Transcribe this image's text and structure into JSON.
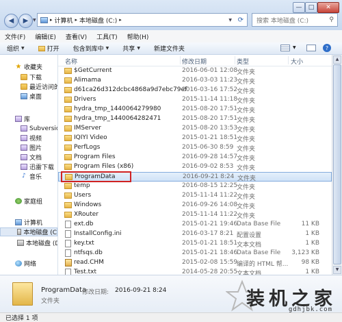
{
  "window": {
    "controls": [
      "—",
      "□",
      "✕"
    ],
    "close_color": "#c8453a"
  },
  "address_bar": {
    "crumbs": [
      "计算机",
      "本地磁盘 (C:)"
    ],
    "separator": "▸",
    "search_placeholder": "搜索 本地磁盘 (C:)"
  },
  "menu": {
    "items": [
      "文件(F)",
      "编辑(E)",
      "查看(V)",
      "工具(T)",
      "帮助(H)"
    ]
  },
  "toolbar": {
    "organize": "组织",
    "open": "打开",
    "include_in_library": "包含到库中",
    "share": "共享",
    "new_folder": "新建文件夹"
  },
  "nav_pane": {
    "favorites": "收藏夹",
    "favorites_items": [
      "下载",
      "最近访问的",
      "桌面"
    ],
    "libraries": "库",
    "library_items": [
      "Subversion",
      "视频",
      "图片",
      "文档",
      "迅雷下载",
      "音乐"
    ],
    "homegroup": "家庭组",
    "computer": "计算机",
    "computer_items": [
      "本地磁盘 (C",
      "本地磁盘 (D"
    ],
    "network": "网络"
  },
  "columns": {
    "name": "名称",
    "date": "修改日期",
    "type": "类型",
    "size": "大小"
  },
  "files": [
    {
      "name": "$GetCurrent",
      "date": "2016-06-01 12:08",
      "type": "文件夹",
      "size": "",
      "icon": "folder-icon"
    },
    {
      "name": "Alimama",
      "date": "2016-03-03 11:23",
      "type": "文件夹",
      "size": "",
      "icon": "folder-icon"
    },
    {
      "name": "d61ca26d312dcbc4868a9d7ebc79ef",
      "date": "2016-03-16 17:52",
      "type": "文件夹",
      "size": "",
      "icon": "folder-icon"
    },
    {
      "name": "Drivers",
      "date": "2015-11-14 11:18",
      "type": "文件夹",
      "size": "",
      "icon": "folder-icon"
    },
    {
      "name": "hydra_tmp_1440064279980",
      "date": "2015-08-20 17:51",
      "type": "文件夹",
      "size": "",
      "icon": "folder-icon"
    },
    {
      "name": "hydra_tmp_1440064282471",
      "date": "2015-08-20 17:51",
      "type": "文件夹",
      "size": "",
      "icon": "folder-icon"
    },
    {
      "name": "IMServer",
      "date": "2015-08-20 13:53",
      "type": "文件夹",
      "size": "",
      "icon": "folder-icon"
    },
    {
      "name": "IQIYI Video",
      "date": "2015-01-21 18:51",
      "type": "文件夹",
      "size": "",
      "icon": "folder-icon"
    },
    {
      "name": "PerfLogs",
      "date": "2015-06-30 8:59",
      "type": "文件夹",
      "size": "",
      "icon": "folder-icon"
    },
    {
      "name": "Program Files",
      "date": "2016-09-28 14:57",
      "type": "文件夹",
      "size": "",
      "icon": "folder-icon"
    },
    {
      "name": "Program Files (x86)",
      "date": "2016-09-02 8:53",
      "type": "文件夹",
      "size": "",
      "icon": "folder-icon"
    },
    {
      "name": "ProgramData",
      "date": "2016-09-21 8:24",
      "type": "文件夹",
      "size": "",
      "icon": "folder-icon",
      "selected": true
    },
    {
      "name": "temp",
      "date": "2016-08-15 12:25",
      "type": "文件夹",
      "size": "",
      "icon": "folder-icon"
    },
    {
      "name": "Users",
      "date": "2015-11-14 11:22",
      "type": "文件夹",
      "size": "",
      "icon": "folder-icon"
    },
    {
      "name": "Windows",
      "date": "2016-09-26 14:08",
      "type": "文件夹",
      "size": "",
      "icon": "folder-icon"
    },
    {
      "name": "XRouter",
      "date": "2015-11-14 11:22",
      "type": "文件夹",
      "size": "",
      "icon": "folder-icon"
    },
    {
      "name": "ext.db",
      "date": "2015-01-21 19:46",
      "type": "Data Base File",
      "size": "11 KB",
      "icon": "file-icon"
    },
    {
      "name": "InstallConfig.ini",
      "date": "2016-03-17 8:21",
      "type": "配置设置",
      "size": "1 KB",
      "icon": "file-icon"
    },
    {
      "name": "key.txt",
      "date": "2015-01-21 18:51",
      "type": "文本文档",
      "size": "1 KB",
      "icon": "file-icon"
    },
    {
      "name": "ntfsqs.db",
      "date": "2015-01-21 18:46",
      "type": "Data Base File",
      "size": "3,123 KB",
      "icon": "file-icon"
    },
    {
      "name": "read.CHM",
      "date": "2015-02-08 15:59",
      "type": "编译的 HTML 帮...",
      "size": "98 KB",
      "icon": "chm-icon"
    },
    {
      "name": "Test.txt",
      "date": "2014-05-28 20:55",
      "type": "文本文档",
      "size": "1 KB",
      "icon": "file-icon"
    }
  ],
  "details": {
    "name": "ProgramData",
    "modified_label": "修改日期:",
    "modified_value": "2016-09-21 8:24",
    "type": "文件夹"
  },
  "status": "已选择 1 项",
  "watermark": {
    "text": "装机之家",
    "url": "gdhjbk.com"
  },
  "highlight_color": "#d02222"
}
